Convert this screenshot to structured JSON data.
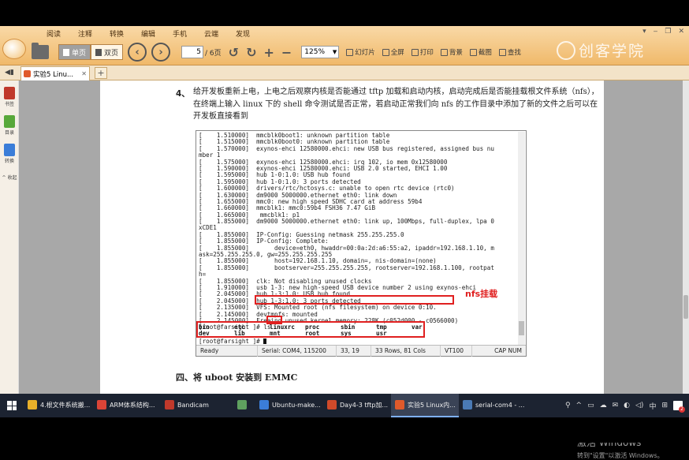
{
  "ribbon": {
    "menus": [
      "阅读",
      "注释",
      "转换",
      "编辑",
      "手机",
      "云端",
      "发现"
    ],
    "window_controls": [
      "▾",
      "‒",
      "❐",
      "✕"
    ],
    "single_page": "单页",
    "double_page": "双页",
    "prev_icon": "‹",
    "next_icon": "›",
    "current_page": "5",
    "page_total": "/ 6页",
    "rotate_left": "↺",
    "rotate_right": "↻",
    "zoom_in": "+",
    "zoom_out": "−",
    "zoom": "125%",
    "slideshow": "幻灯片",
    "fullscreen": "全屏",
    "print": "打印",
    "background": "背景",
    "screenshot": "截图",
    "search": "查找"
  },
  "brand": "创客学院",
  "tabs": {
    "pin": "◀▮",
    "doc_tab": "实验5 Linu...",
    "close": "✕",
    "add": "+"
  },
  "siderail": {
    "thumbnails": "书签",
    "outline": "目录",
    "convert": "转换",
    "collapse": "^ 收起"
  },
  "document": {
    "step_number": "4、",
    "step_text": "给开发板重新上电，上电之后观察内核是否能通过 tftp 加载和启动内核，启动完成后是否能挂载根文件系统（nfs），在终端上输入 linux 下的 shell 命令测试是否正常，若启动正常我们向 nfs 的工作目录中添加了新的文件之后可以在开发板直接看到",
    "section_heading": "四、将 uboot 安装到 EMMC",
    "annotation": "nfs挂载"
  },
  "terminal": {
    "lines": [
      "[    1.510000]  mmcblk0boot1: unknown partition table",
      "[    1.515000]  mmcblk0boot0: unknown partition table",
      "[    1.570000]  exynos-ehci 12580000.ehci: new USB bus registered, assigned bus nu",
      "mber 1",
      "[    1.575000]  exynos-ehci 12580000.ehci: irq 102, io mem 0x12580000",
      "[    1.590000]  exynos-ehci 12580000.ehci: USB 2.0 started, EHCI 1.00",
      "[    1.595000]  hub 1-0:1.0: USB hub found",
      "[    1.595000]  hub 1-0:1.0: 3 ports detected",
      "[    1.600000]  drivers/rtc/hctosys.c: unable to open rtc device (rtc0)",
      "[    1.630000]  dm9000 5000000.ethernet eth0: link down",
      "[    1.655000]  mmc0: new high speed SDHC card at address 59b4",
      "[    1.660000]  mmcblk1: mmc0:59b4 FSH36 7.47 GiB",
      "[    1.665000]   mmcblk1: p1",
      "[    1.855000]  dm9000 5000000.ethernet eth0: link up, 100Mbps, full-duplex, lpa 0",
      "xCDE1",
      "[    1.855000]  IP-Config: Guessing netmask 255.255.255.0",
      "[    1.855000]  IP-Config: Complete:",
      "[    1.855000]       device=eth0, hwaddr=00:0a:2d:a6:55:a2, ipaddr=192.168.1.10, m",
      "ask=255.255.255.0, gw=255.255.255.255",
      "[    1.855000]       host=192.168.1.10, domain=, nis-domain=(none)",
      "[    1.855000]       bootserver=255.255.255.255, rootserver=192.168.1.100, rootpat",
      "h=",
      "[    1.855000]  clk: Not disabling unused clocks",
      "[    1.910000]  usb 1-3: new high-speed USB device number 2 using exynos-ehci",
      "[    2.045000]  hub 1-3:1.0: USB hub found",
      "[    2.045000]  hub 1-3:1.0: 3 ports detected",
      "[    2.135000]  VFS: Mounted root (nfs filesystem) on device 0:10.",
      "[    2.145000]  devtmpfs: mounted",
      "[    2.145000]  Freeing unused kernel memory: 228K (c052d000 - c0566000)",
      "[root@farsight ]# ls"
    ],
    "ls_row1": [
      "bin",
      "etc",
      "linuxrc",
      "proc",
      "sbin",
      "tmp",
      "var"
    ],
    "ls_row2": [
      "dev",
      "lib",
      "mnt",
      "root",
      "sys",
      "usr"
    ],
    "prompt": "[root@farsight ]# ",
    "status": {
      "ready": "Ready",
      "serial": "Serial: COM4, 115200",
      "position": "33,  19",
      "size": "33 Rows, 81 Cols",
      "term": "VT100",
      "caps": "CAP  NUM"
    }
  },
  "watermark": {
    "title": "激活 Windows",
    "subtitle": "转到\"设置\"以激活 Windows。"
  },
  "taskbar": {
    "items": [
      {
        "label": "4.根文件系统搬...",
        "color": "#e8b02a"
      },
      {
        "label": "ARM体系结构...",
        "color": "#db4437"
      },
      {
        "label": "Bandicam",
        "color": "#c0392b"
      },
      {
        "label": "",
        "color": "#5fa15f"
      },
      {
        "label": "Ubuntu-make...",
        "color": "#3b7dd8"
      },
      {
        "label": "Day4-3 tftp加...",
        "color": "#d04a2a"
      },
      {
        "label": "实验5 Linux内...",
        "color": "#e05a2b"
      },
      {
        "label": "serial-com4 - ...",
        "color": "#4a7ab5"
      }
    ],
    "tray_icons": [
      "⚲",
      "^",
      "▭",
      "☁",
      "✉",
      "◐",
      "◁)",
      "中",
      "⊞"
    ],
    "notification_count": "2"
  }
}
